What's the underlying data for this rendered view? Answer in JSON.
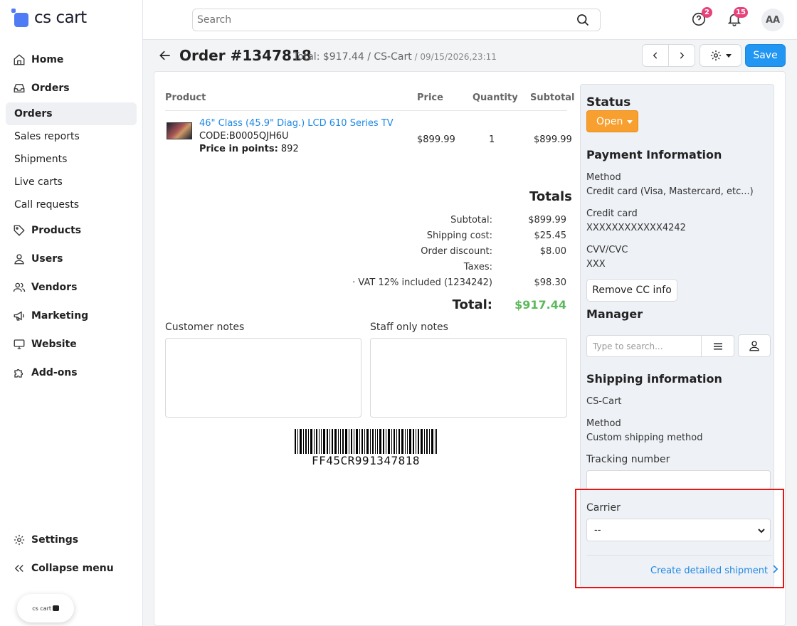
{
  "brand": {
    "logo_text": "cs cart",
    "mini_logo_text": "cs cart",
    "mini_logo_tag": ""
  },
  "sidebar": {
    "items": [
      {
        "label": "Home",
        "icon": "home-icon"
      },
      {
        "label": "Orders",
        "icon": "inbox-icon"
      },
      {
        "label": "Orders",
        "sub": true,
        "active": true
      },
      {
        "label": "Sales reports",
        "sub": true
      },
      {
        "label": "Shipments",
        "sub": true
      },
      {
        "label": "Live carts",
        "sub": true
      },
      {
        "label": "Call requests",
        "sub": true
      },
      {
        "label": "Products",
        "icon": "tag-icon"
      },
      {
        "label": "Users",
        "icon": "user-icon"
      },
      {
        "label": "Vendors",
        "icon": "users-icon"
      },
      {
        "label": "Marketing",
        "icon": "megaphone-icon"
      },
      {
        "label": "Website",
        "icon": "monitor-icon"
      },
      {
        "label": "Add-ons",
        "icon": "puzzle-icon"
      }
    ],
    "settings_label": "Settings",
    "collapse_label": "Collapse menu"
  },
  "topbar": {
    "search_placeholder": "Search",
    "help_badge": "2",
    "notif_badge": "15",
    "avatar": "AA"
  },
  "header": {
    "title": "Order #1347818",
    "meta": "Total: $917.44 / CS-Cart",
    "date": " / 09/15/2026,23:11",
    "save_label": "Save"
  },
  "products_table": {
    "headers": {
      "product": "Product",
      "price": "Price",
      "quantity": "Quantity",
      "subtotal": "Subtotal"
    },
    "rows": [
      {
        "name": "46\" Class (45.9\" Diag.) LCD 610 Series TV",
        "code": "CODE:B0005QJH6U",
        "points_label": "Price in points:",
        "points": " 892",
        "price": "$899.99",
        "quantity": "1",
        "subtotal": "$899.99"
      }
    ]
  },
  "totals": {
    "heading": "Totals",
    "lines": [
      {
        "label": "Subtotal:",
        "value": "$899.99"
      },
      {
        "label": "Shipping cost:",
        "value": "$25.45"
      },
      {
        "label": "Order discount:",
        "value": "$8.00"
      },
      {
        "label": "Taxes:",
        "value": ""
      },
      {
        "label": "· VAT 12% included (1234242)",
        "value": "$98.30"
      }
    ],
    "total_label": "Total:",
    "total_value": "$917.44"
  },
  "notes": {
    "customer_label": "Customer notes",
    "staff_label": "Staff only notes"
  },
  "barcode": {
    "text": "FF45CR991347818"
  },
  "right_panel": {
    "status_heading": "Status",
    "status_value": "Open",
    "payment_heading": "Payment Information",
    "method_label": "Method",
    "method_value": "Credit card (Visa, Mastercard, etc...)",
    "cc_label": "Credit card",
    "cc_value": "XXXXXXXXXXXX4242",
    "cvv_label": "CVV/CVC",
    "cvv_value": "XXX",
    "remove_cc_label": "Remove CC info",
    "manager_heading": "Manager",
    "manager_placeholder": "Type to search...",
    "shipping_heading": "Shipping information",
    "shipping_company": "CS-Cart",
    "ship_method_label": "Method",
    "ship_method_value": "Custom shipping method",
    "tracking_label": "Tracking number",
    "carrier_label": "Carrier",
    "carrier_value": "--",
    "create_shipment_label": "Create detailed shipment"
  },
  "colors": {
    "accent": "#2196f3",
    "status_open": "#f7a030",
    "total_green": "#5cb85c",
    "badge": "#e8427a",
    "highlight": "#ee1111"
  }
}
